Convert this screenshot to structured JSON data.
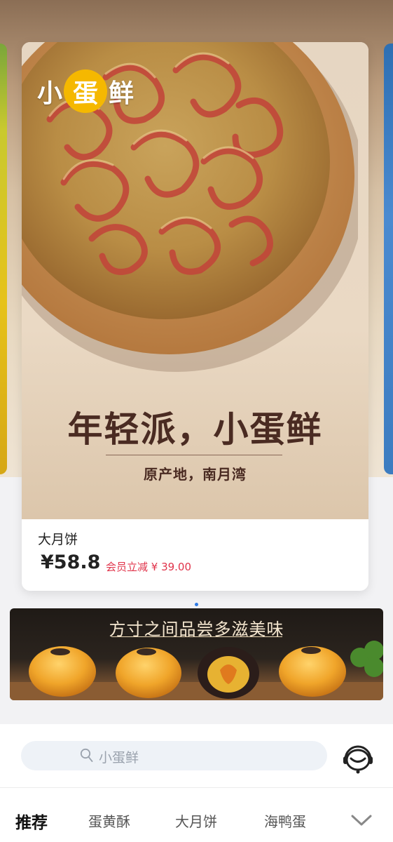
{
  "carousel": {
    "card": {
      "brand_logo": {
        "left": "小",
        "egg": "蛋",
        "right": "鲜"
      },
      "slogan": "年轻派，小蛋鲜",
      "subslogan": "原产地，南月湾",
      "product_name": "大月饼",
      "price": "¥58.8",
      "member_discount": "会员立减 ¥ 39.00"
    }
  },
  "banner": {
    "title": "方寸之间品尝多滋美味"
  },
  "search": {
    "placeholder": "小蛋鲜"
  },
  "tabs": [
    {
      "label": "推荐"
    },
    {
      "label": "蛋黄酥"
    },
    {
      "label": "大月饼"
    },
    {
      "label": "海鸭蛋"
    }
  ],
  "colors": {
    "accent_blue": "#2f7be5",
    "discount_red": "#e0334a",
    "logo_yellow": "#f5b800",
    "slogan_brown": "#4a2b22"
  }
}
